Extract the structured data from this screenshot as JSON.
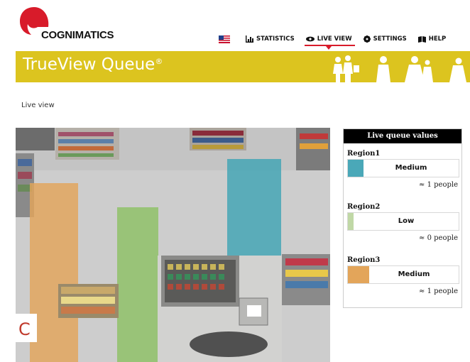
{
  "brand": {
    "name": "COGNIMATICS",
    "product": "TrueView Queue",
    "trademark": "®"
  },
  "colors": {
    "banner": "#dcc41f",
    "logo_red": "#d81b2a",
    "region1": "#4aa8b8",
    "region2": "#c0d8a6",
    "region3": "#e3a55a"
  },
  "nav": {
    "flag_icon": "us-flag-icon",
    "items": [
      {
        "label": "STATISTICS",
        "icon": "bar-chart-icon"
      },
      {
        "label": "LIVE VIEW",
        "icon": "eye-icon",
        "active": true
      },
      {
        "label": "SETTINGS",
        "icon": "gear-icon"
      },
      {
        "label": "HELP",
        "icon": "book-icon"
      }
    ]
  },
  "page": {
    "heading": "Live view"
  },
  "panel": {
    "title": "Live queue values",
    "regions": [
      {
        "name": "Region1",
        "level": "Medium",
        "people": "≈ 1 people"
      },
      {
        "name": "Region2",
        "level": "Low",
        "people": "≈ 0 people"
      },
      {
        "name": "Region3",
        "level": "Medium",
        "people": "≈ 1 people"
      }
    ]
  }
}
